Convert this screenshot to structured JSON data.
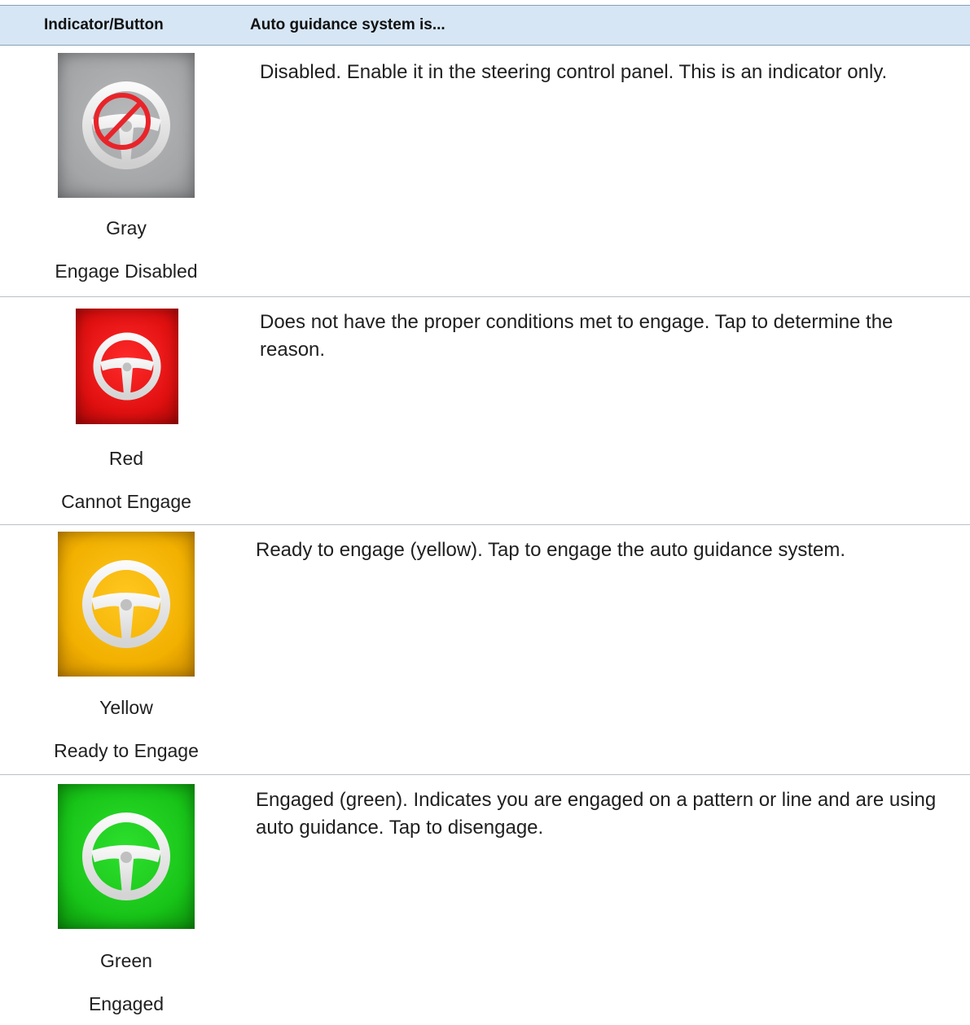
{
  "header": {
    "col1": "Indicator/Button",
    "col2": "Auto guidance system is..."
  },
  "rows": [
    {
      "color_name": "Gray",
      "state": "Engage Disabled",
      "description": "Disabled. Enable it in the steering control panel. This is an indicator only.",
      "icon": "steering-wheel-disabled-icon",
      "bg_color": "#a8a9ab"
    },
    {
      "color_name": "Red",
      "state": "Cannot Engage",
      "description": "Does not have the proper conditions met to engage. Tap to determine the reason.",
      "icon": "steering-wheel-icon",
      "bg_color": "#e81414"
    },
    {
      "color_name": "Yellow",
      "state": "Ready to Engage",
      "description": "Ready to engage (yellow). Tap to engage the auto guidance system.",
      "icon": "steering-wheel-icon",
      "bg_color": "#f4b400"
    },
    {
      "color_name": "Green",
      "state": "Engaged",
      "description": "Engaged (green). Indicates you are engaged on a pattern or line and are using auto guidance. Tap to disengage.",
      "icon": "steering-wheel-icon",
      "bg_color": "#17c417"
    }
  ]
}
